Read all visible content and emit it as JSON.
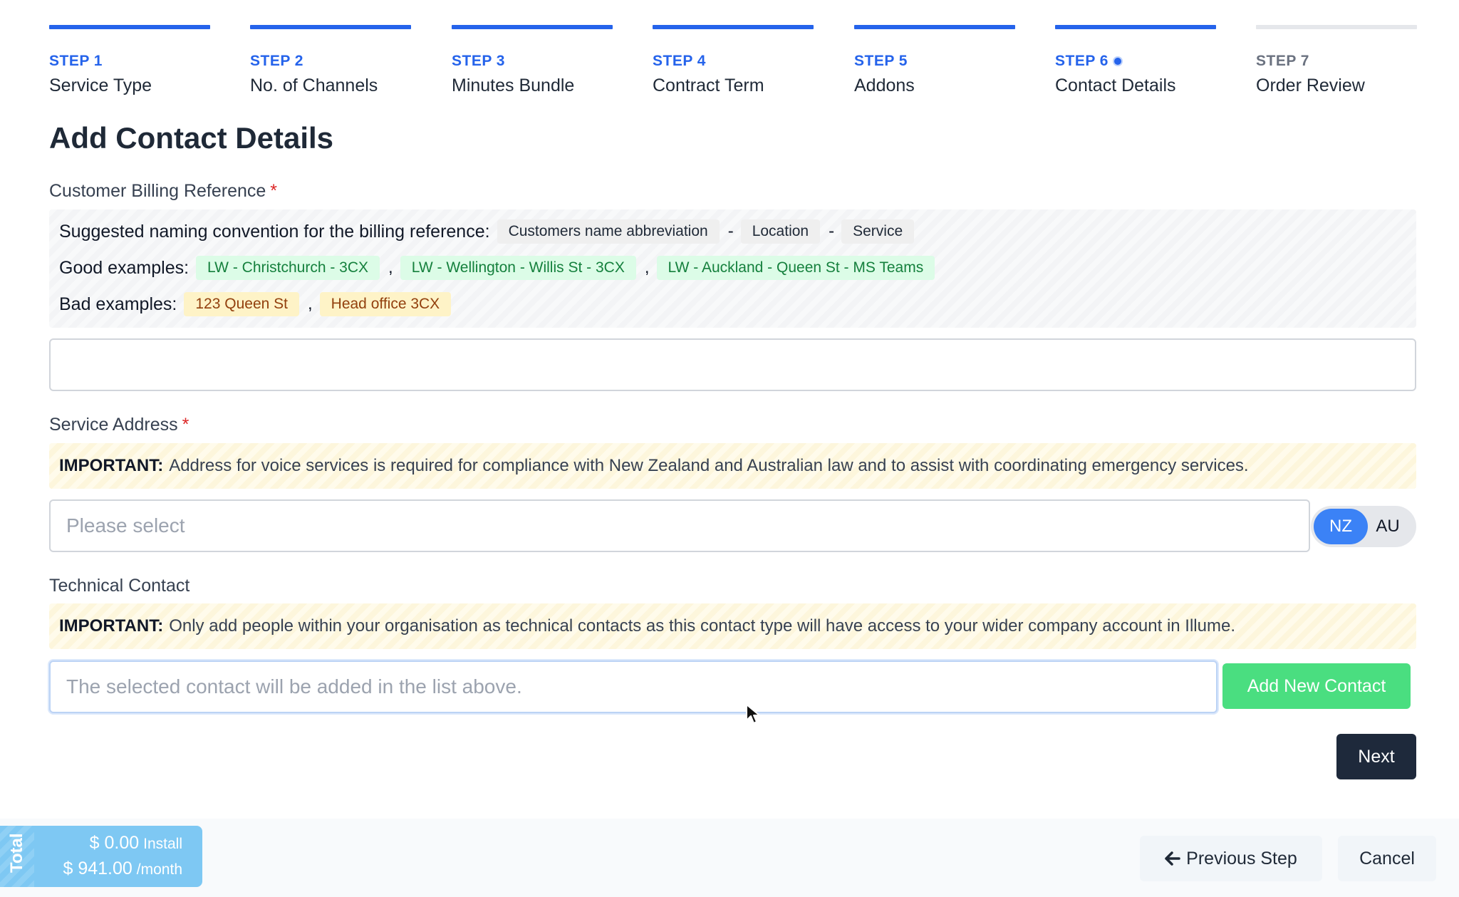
{
  "stepper": {
    "steps": [
      {
        "label": "STEP 1",
        "title": "Service Type",
        "state": "complete"
      },
      {
        "label": "STEP 2",
        "title": "No. of Channels",
        "state": "complete"
      },
      {
        "label": "STEP 3",
        "title": "Minutes Bundle",
        "state": "complete"
      },
      {
        "label": "STEP 4",
        "title": "Contract Term",
        "state": "complete"
      },
      {
        "label": "STEP 5",
        "title": "Addons",
        "state": "complete"
      },
      {
        "label": "STEP 6",
        "title": "Contact Details",
        "state": "current"
      },
      {
        "label": "STEP 7",
        "title": "Order Review",
        "state": "pending"
      }
    ]
  },
  "page": {
    "title": "Add Contact Details"
  },
  "billing": {
    "label": "Customer Billing Reference",
    "required_mark": "*",
    "convention_text": "Suggested naming convention for the billing reference:",
    "convention_parts": [
      "Customers name abbreviation",
      "Location",
      "Service"
    ],
    "dash": "-",
    "good_label": "Good examples:",
    "good_examples": [
      "LW - Christchurch - 3CX",
      "LW - Wellington - Willis St - 3CX",
      "LW - Auckland - Queen St - MS Teams"
    ],
    "bad_label": "Bad examples:",
    "bad_examples": [
      "123 Queen St",
      "Head office 3CX"
    ],
    "comma": ",",
    "value": ""
  },
  "address": {
    "label": "Service Address",
    "required_mark": "*",
    "important_prefix": "IMPORTANT:",
    "important_text": "Address for voice services is required for compliance with New Zealand and Australian law and to assist with coordinating emergency services.",
    "placeholder": "Please select",
    "country_options": [
      "NZ",
      "AU"
    ],
    "country_selected": "NZ"
  },
  "technical": {
    "label": "Technical Contact",
    "important_prefix": "IMPORTANT:",
    "important_text": "Only add people within your organisation as technical contacts as this contact type will have access to your wider company account in Illume.",
    "placeholder": "The selected contact will be added in the list above.",
    "add_button": "Add New Contact"
  },
  "actions": {
    "next": "Next",
    "previous": "Previous Step",
    "cancel": "Cancel"
  },
  "total": {
    "tab_label": "Total",
    "install_amount": "$ 0.00",
    "install_unit": "Install",
    "monthly_amount": "$ 941.00",
    "monthly_unit": "/month"
  },
  "colors": {
    "primary": "#2563eb",
    "success": "#4ade80",
    "dark": "#1e293b",
    "total_bg": "#7ec8f3"
  }
}
